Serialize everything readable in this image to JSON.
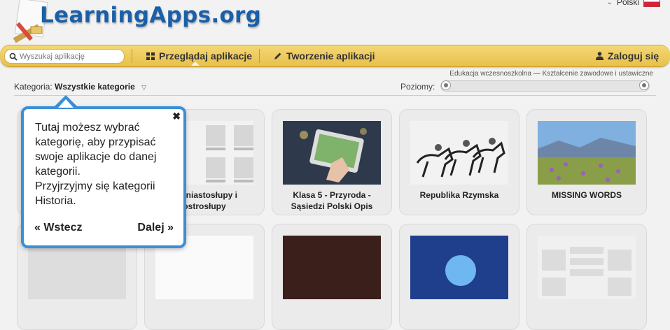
{
  "header": {
    "logo_text": "LearningApps.org",
    "language": "Polski"
  },
  "nav": {
    "search_placeholder": "Wyszukaj aplikację",
    "browse_label": "Przeglądaj aplikacje",
    "create_label": "Tworzenie aplikacji",
    "login_label": "Zaloguj się"
  },
  "filters": {
    "category_label": "Kategoria:",
    "category_value": "Wszystkie kategorie",
    "levels_label": "Poziomy:",
    "level_range": "Edukacja wczesnoszkolna — Kształcenie zawodowe i ustawiczne"
  },
  "apps": [
    {
      "title": ""
    },
    {
      "title_line1": "Graniastosłupy i",
      "title_line2": "ostrosłupy"
    },
    {
      "title_line1": "Klasa 5 - Przyroda -",
      "title_line2": "Sąsiedzi Polski Opis"
    },
    {
      "title_line1": "Republika Rzymska",
      "title_line2": ""
    },
    {
      "title_line1": "MISSING WORDS",
      "title_line2": ""
    }
  ],
  "tooltip": {
    "text_line1": "Tutaj możesz wybrać",
    "text_line2": "kategorię, aby przypisać",
    "text_line3": "swoje aplikacje do danej",
    "text_line4": "kategorii.",
    "text_line5": "Przyjrzyjmy się kategorii",
    "text_line6": "Historia.",
    "back_label": "« Wstecz",
    "next_label": "Dalej »",
    "close_glyph": "✖"
  },
  "colors": {
    "accent": "#3b8fd8",
    "navbar": "#f0cf66",
    "logo": "#1a5fa8"
  }
}
